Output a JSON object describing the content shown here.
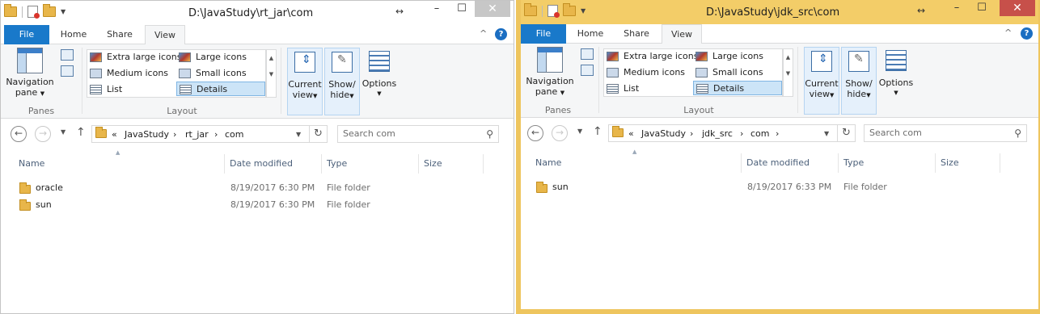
{
  "windows": [
    {
      "title": "D:\\JavaStudy\\rt_jar\\com",
      "tabs": {
        "file": "File",
        "home": "Home",
        "share": "Share",
        "view": "View"
      },
      "ribbon": {
        "nav_pane_line1": "Navigation",
        "nav_pane_line2": "pane",
        "panes_label": "Panes",
        "layout_items": [
          "Extra large icons",
          "Large icons",
          "Medium icons",
          "Small icons",
          "List",
          "Details"
        ],
        "layout_selected": "Details",
        "layout_label": "Layout",
        "current_view_line1": "Current",
        "current_view_line2": "view",
        "show_hide_line1": "Show/",
        "show_hide_line2": "hide",
        "options": "Options",
        "help": "?"
      },
      "address": {
        "prefix": "«",
        "crumbs": [
          "JavaStudy",
          "rt_jar",
          "com"
        ],
        "separator": "›"
      },
      "search_placeholder": "Search com",
      "columns": {
        "name": "Name",
        "date": "Date modified",
        "type": "Type",
        "size": "Size"
      },
      "files": [
        {
          "name": "oracle",
          "date": "8/19/2017 6:30 PM",
          "type": "File folder"
        },
        {
          "name": "sun",
          "date": "8/19/2017 6:30 PM",
          "type": "File folder"
        }
      ]
    },
    {
      "title": "D:\\JavaStudy\\jdk_src\\com",
      "tabs": {
        "file": "File",
        "home": "Home",
        "share": "Share",
        "view": "View"
      },
      "ribbon": {
        "nav_pane_line1": "Navigation",
        "nav_pane_line2": "pane",
        "panes_label": "Panes",
        "layout_items": [
          "Extra large icons",
          "Large icons",
          "Medium icons",
          "Small icons",
          "List",
          "Details"
        ],
        "layout_selected": "Details",
        "layout_label": "Layout",
        "current_view_line1": "Current",
        "current_view_line2": "view",
        "show_hide_line1": "Show/",
        "show_hide_line2": "hide",
        "options": "Options",
        "help": "?"
      },
      "address": {
        "prefix": "«",
        "crumbs": [
          "JavaStudy",
          "jdk_src",
          "com"
        ],
        "separator": "›"
      },
      "search_placeholder": "Search com",
      "columns": {
        "name": "Name",
        "date": "Date modified",
        "type": "Type",
        "size": "Size"
      },
      "files": [
        {
          "name": "sun",
          "date": "8/19/2017 6:33 PM",
          "type": "File folder"
        }
      ]
    }
  ],
  "icons": {
    "minimize": "–",
    "maximize": "☐",
    "close": "✕",
    "resize": "↔",
    "back": "←",
    "forward": "→",
    "up": "↑",
    "refresh": "↻",
    "search": "⚲",
    "chevron_up": "^",
    "dropdown": "▼",
    "sort": "▲"
  },
  "colors": {
    "accent": "#1979ca",
    "active_window_border": "#eec55e"
  }
}
